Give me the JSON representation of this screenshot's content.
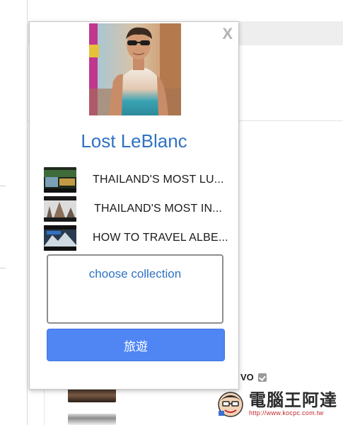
{
  "popup": {
    "close_label": "X",
    "channel_name": "Lost LeBlanc",
    "videos": [
      {
        "title": "THAILAND'S MOST LU..."
      },
      {
        "title": "THAILAND'S MOST IN..."
      },
      {
        "title": "HOW TO TRAVEL ALBE..."
      }
    ],
    "collection_placeholder": "choose collection",
    "collection_button_label": "旅遊"
  },
  "background": {
    "channel_fragment": "VO"
  },
  "watermark": {
    "title": "電腦王阿達",
    "url": "http://www.kocpc.com.tw"
  },
  "colors": {
    "accent_blue": "#4f86f4",
    "link_blue": "#2f72c4"
  },
  "icons": {
    "close": "close-icon",
    "verified": "verified-icon"
  }
}
